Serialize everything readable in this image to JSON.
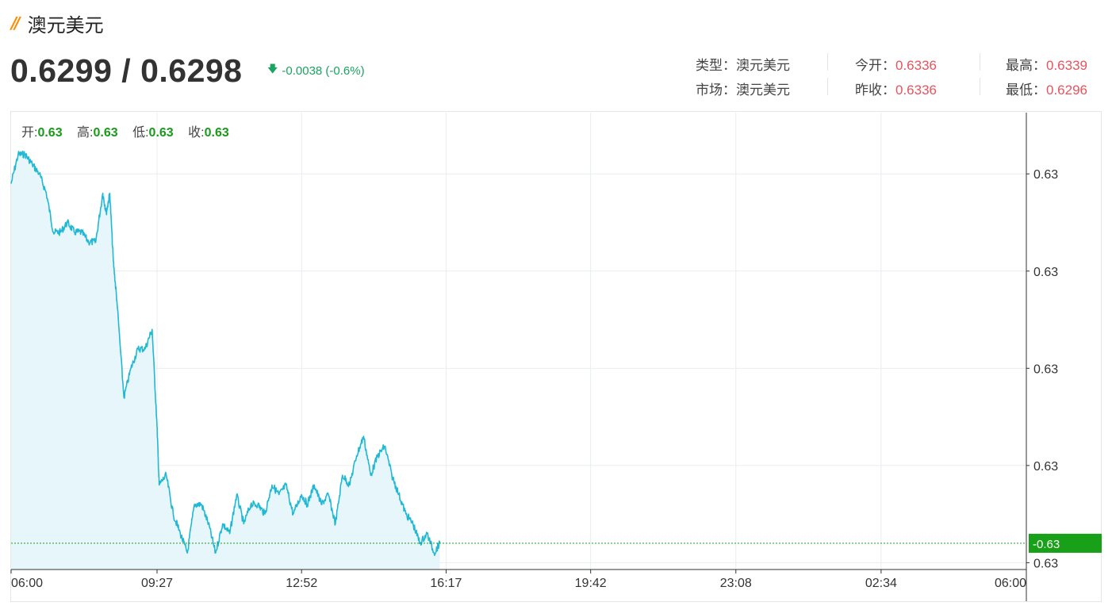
{
  "header": {
    "logo_icon": "double-slash-icon",
    "title": "澳元美元",
    "price_text": "0.6299 / 0.6298",
    "change_icon": "arrow-down-icon",
    "change_text": "-0.0038 (-0.6%)",
    "change_color": "#1aa361"
  },
  "stats": {
    "type_label": "类型：",
    "type_value": "澳元美元",
    "market_label": "市场：",
    "market_value": "澳元美元",
    "open_label": "今开：",
    "open_value": "0.6336",
    "prev_close_label": "昨收：",
    "prev_close_value": "0.6336",
    "high_label": "最高：",
    "high_value": "0.6339",
    "low_label": "最低：",
    "low_value": "0.6296",
    "value_color": "#e8535e"
  },
  "ohlc": {
    "open_label": "开:",
    "open_value": "0.63",
    "high_label": "高:",
    "high_value": "0.63",
    "low_label": "低:",
    "low_value": "0.63",
    "close_label": "收:",
    "close_value": "0.63"
  },
  "chart_data": {
    "type": "area",
    "title": "",
    "xlabel": "",
    "ylabel": "",
    "x_ticks": [
      "06:00",
      "09:27",
      "12:52",
      "16:17",
      "19:42",
      "23:08",
      "02:34",
      "06:00"
    ],
    "y_tick_labels": [
      "0.63",
      "0.63",
      "0.63",
      "0.63",
      "0.63"
    ],
    "y_tick_values": [
      0.6336,
      0.6326,
      0.6316,
      0.6306,
      0.6296
    ],
    "ylim": [
      0.62953,
      0.63423
    ],
    "xlim_hours": [
      6.0,
      30.0
    ],
    "current_value": 0.6298,
    "current_label": "0.63",
    "line_color": "#20b8d4",
    "fill_color": "#e6f6fa",
    "current_line_color": "#19a019",
    "current_badge_color": "#19a019",
    "grid": true,
    "series": [
      {
        "x": [
          "06:00",
          "06:10",
          "06:20",
          "06:30",
          "06:40",
          "06:50",
          "07:00",
          "07:10",
          "07:20",
          "07:30",
          "07:40",
          "07:50",
          "08:00",
          "08:10",
          "08:15",
          "08:20",
          "08:25",
          "08:30",
          "08:40",
          "08:50",
          "09:00",
          "09:10",
          "09:20",
          "09:27",
          "09:30",
          "09:40",
          "09:50",
          "10:00",
          "10:10",
          "10:20",
          "10:30",
          "10:40",
          "10:50",
          "11:00",
          "11:10",
          "11:20",
          "11:30",
          "11:40",
          "11:50",
          "12:00",
          "12:10",
          "12:20",
          "12:30",
          "12:40",
          "12:52",
          "13:00",
          "13:10",
          "13:20",
          "13:30",
          "13:40",
          "13:50",
          "14:00",
          "14:10",
          "14:20",
          "14:30",
          "14:40",
          "14:50",
          "15:00",
          "15:10",
          "15:20",
          "15:30",
          "15:40",
          "15:50",
          "16:00",
          "16:08"
        ],
        "y": [
          0.6335,
          0.6338,
          0.6338,
          0.6337,
          0.6336,
          0.6334,
          0.633,
          0.633,
          0.6331,
          0.633,
          0.633,
          0.6329,
          0.6329,
          0.6334,
          0.6332,
          0.6334,
          0.6327,
          0.6323,
          0.6313,
          0.6316,
          0.6318,
          0.6318,
          0.632,
          0.631,
          0.6304,
          0.6305,
          0.6301,
          0.6299,
          0.6297,
          0.6302,
          0.6302,
          0.63,
          0.6297,
          0.63,
          0.6299,
          0.6303,
          0.63,
          0.6302,
          0.6302,
          0.6301,
          0.6304,
          0.6303,
          0.6304,
          0.6301,
          0.6303,
          0.6302,
          0.6304,
          0.6302,
          0.6303,
          0.63,
          0.6305,
          0.6304,
          0.6307,
          0.6309,
          0.6305,
          0.6307,
          0.6308,
          0.6305,
          0.6303,
          0.6301,
          0.63,
          0.6298,
          0.6299,
          0.6297,
          0.6298
        ]
      }
    ]
  }
}
